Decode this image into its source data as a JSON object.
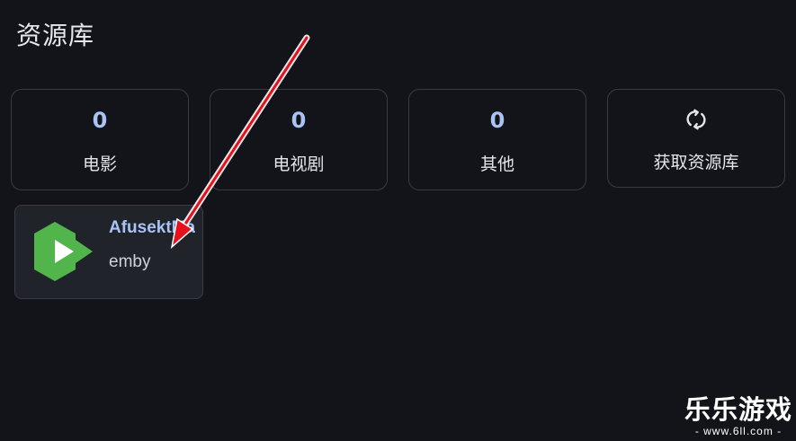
{
  "page": {
    "title": "资源库"
  },
  "stats": [
    {
      "count": "0",
      "label": "电影"
    },
    {
      "count": "0",
      "label": "电视剧"
    },
    {
      "count": "0",
      "label": "其他"
    }
  ],
  "fetch_library": {
    "label": "获取资源库",
    "icon": "refresh-icon"
  },
  "server": {
    "name": "AfusektMan",
    "type": "emby",
    "logo_icon": "emby-logo",
    "logo_color": "#52b54b"
  },
  "watermark": {
    "title": "乐乐游戏",
    "url": "- www.6ll.com -"
  },
  "colors": {
    "background": "#131419",
    "accent": "#a9c3f4",
    "card_border": "#3a3b42",
    "annotation_arrow": "#e8101c"
  }
}
